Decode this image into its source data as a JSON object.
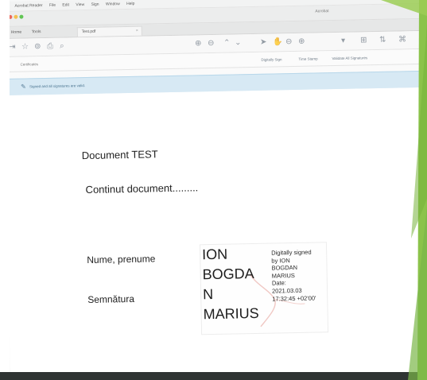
{
  "menubar": {
    "apple": "",
    "items": [
      "Acrobat Reader",
      "File",
      "Edit",
      "View",
      "Sign",
      "Window",
      "Help"
    ]
  },
  "window": {
    "title": "Acrobat"
  },
  "tabs": {
    "home": "Home",
    "tools": "Tools",
    "document": "Test.pdf",
    "close": "×"
  },
  "toolbar": {
    "icons": [
      "⇥",
      "☆",
      "⊚",
      "⎙",
      "⌕",
      "⊕",
      "⊖",
      "⌃",
      "⌄",
      "➤",
      "✋",
      "⊖",
      "⊕",
      "▾",
      "⊞",
      "⇅",
      "⌘"
    ]
  },
  "certbar": {
    "label": "Certificates",
    "actions": [
      "Digitally Sign",
      "Time Stamp",
      "Validate All Signatures"
    ]
  },
  "signature_banner": {
    "icon": "✎",
    "text": "Signed and all signatures are valid."
  },
  "document": {
    "title": "Document TEST",
    "content": "Continut document.........",
    "name_label": "Nume, prenume",
    "signature_label": "Semnătura"
  },
  "signature": {
    "name_lines": [
      "ION",
      "BOGDA",
      "N",
      "MARIUS"
    ],
    "info_lines": [
      "Digitally signed",
      "by ION",
      "BOGDAN",
      "MARIUS",
      "Date:",
      "2021.03.03",
      "17:32:45 +02'00'"
    ]
  },
  "colors": {
    "green_accent": "#8bc34a",
    "banner_bg": "#d7e9f4",
    "bottom_bar": "#2f3433"
  }
}
